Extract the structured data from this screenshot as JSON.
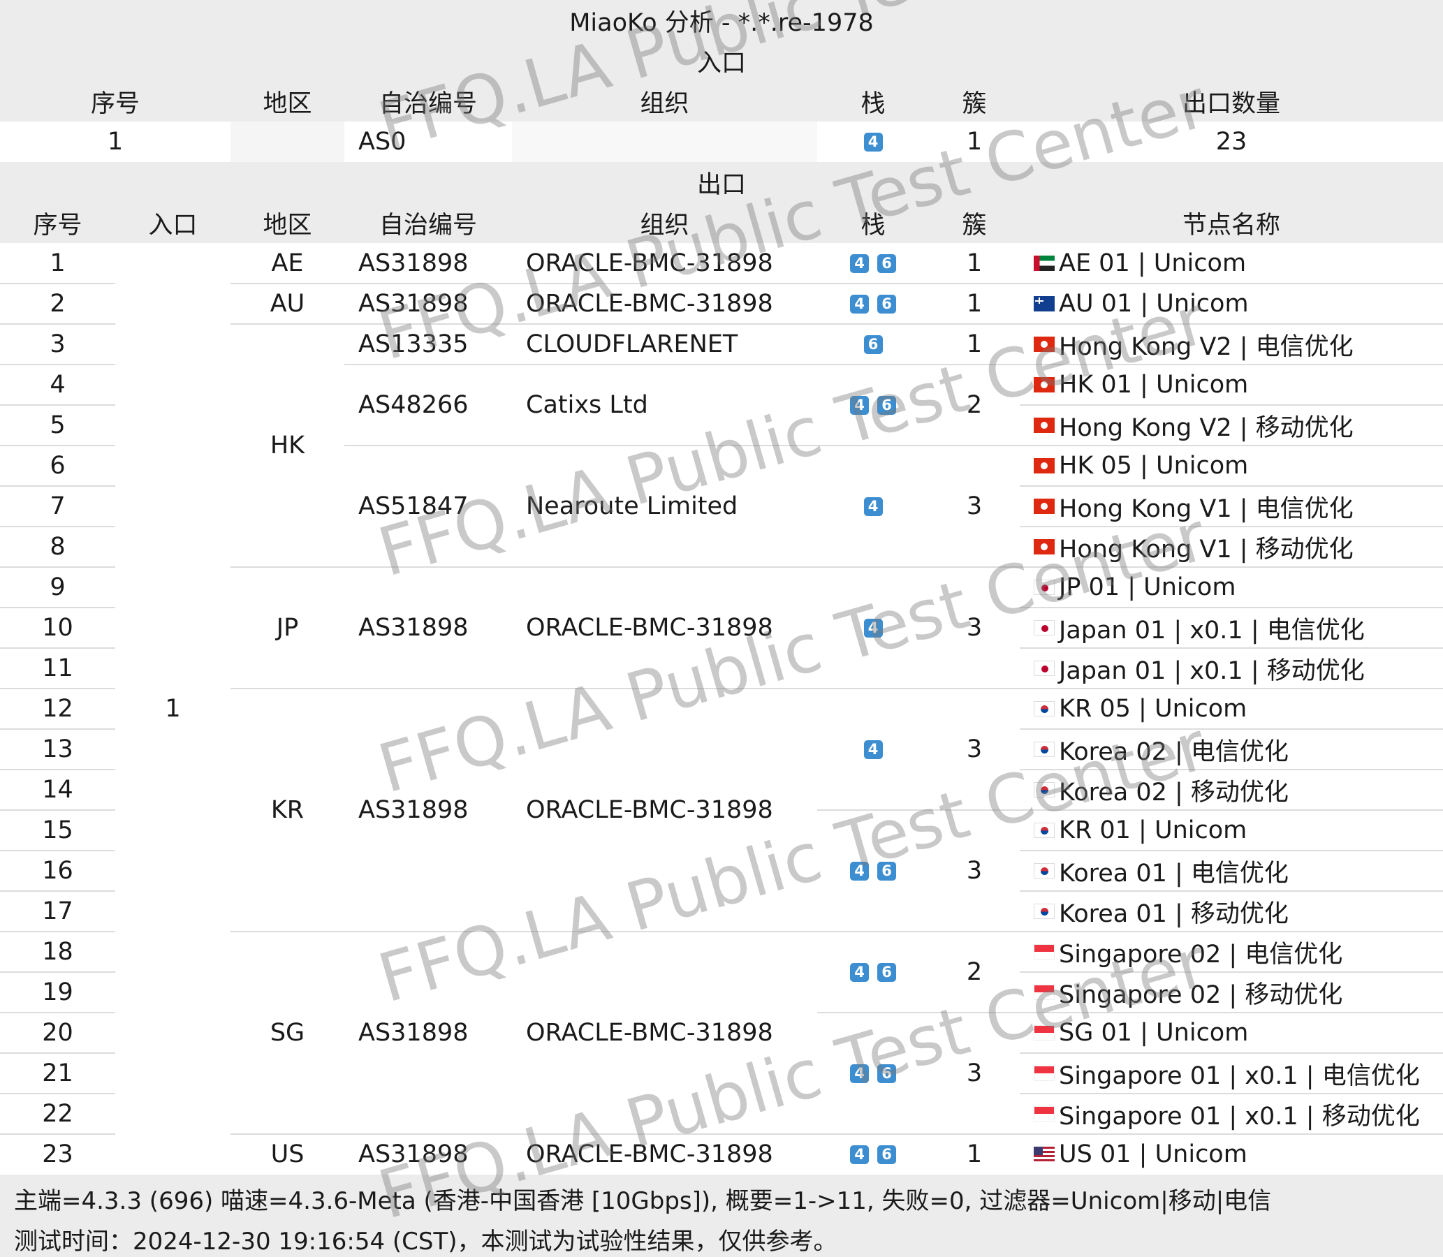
{
  "title": "MiaoKo 分析 - *.*.re-1978",
  "entry_section": {
    "label": "入口",
    "headers": [
      "序号",
      "地区",
      "自治编号",
      "组织",
      "栈",
      "簇",
      "出口数量"
    ],
    "row": {
      "index": "1",
      "region": "",
      "asn": "AS0",
      "org": "",
      "stack": [
        "4"
      ],
      "cluster": "1",
      "exit_count": "23"
    }
  },
  "exit_section": {
    "label": "出口",
    "headers": [
      "序号",
      "入口",
      "地区",
      "自治编号",
      "组织",
      "栈",
      "簇",
      "节点名称"
    ],
    "entry_value": "1",
    "indices": [
      "1",
      "2",
      "3",
      "4",
      "5",
      "6",
      "7",
      "8",
      "9",
      "10",
      "11",
      "12",
      "13",
      "14",
      "15",
      "16",
      "17",
      "18",
      "19",
      "20",
      "21",
      "22",
      "23"
    ],
    "region_groups": [
      {
        "region": "AE",
        "rows": 1
      },
      {
        "region": "AU",
        "rows": 1
      },
      {
        "region": "HK",
        "rows": 6
      },
      {
        "region": "JP",
        "rows": 3
      },
      {
        "region": "KR",
        "rows": 6
      },
      {
        "region": "SG",
        "rows": 5
      },
      {
        "region": "US",
        "rows": 1
      }
    ],
    "asn_groups": [
      {
        "asn": "AS31898",
        "org": "ORACLE-BMC-31898",
        "rows": 1
      },
      {
        "asn": "AS31898",
        "org": "ORACLE-BMC-31898",
        "rows": 1
      },
      {
        "asn": "AS13335",
        "org": "CLOUDFLARENET",
        "rows": 1
      },
      {
        "asn": "AS48266",
        "org": "Catixs Ltd",
        "rows": 2
      },
      {
        "asn": "AS51847",
        "org": "Nearoute Limited",
        "rows": 3
      },
      {
        "asn": "AS31898",
        "org": "ORACLE-BMC-31898",
        "rows": 3
      },
      {
        "asn": "AS31898",
        "org": "ORACLE-BMC-31898",
        "rows": 6
      },
      {
        "asn": "AS31898",
        "org": "ORACLE-BMC-31898",
        "rows": 5
      },
      {
        "asn": "AS31898",
        "org": "ORACLE-BMC-31898",
        "rows": 1
      }
    ],
    "cluster_groups": [
      {
        "stack": [
          "4",
          "6"
        ],
        "cluster": "1",
        "rows": 1
      },
      {
        "stack": [
          "4",
          "6"
        ],
        "cluster": "1",
        "rows": 1
      },
      {
        "stack": [
          "6"
        ],
        "cluster": "1",
        "rows": 1
      },
      {
        "stack": [
          "4",
          "6"
        ],
        "cluster": "2",
        "rows": 2
      },
      {
        "stack": [
          "4"
        ],
        "cluster": "3",
        "rows": 3
      },
      {
        "stack": [
          "4"
        ],
        "cluster": "3",
        "rows": 3
      },
      {
        "stack": [
          "4"
        ],
        "cluster": "3",
        "rows": 3
      },
      {
        "stack": [
          "4",
          "6"
        ],
        "cluster": "3",
        "rows": 3
      },
      {
        "stack": [
          "4",
          "6"
        ],
        "cluster": "2",
        "rows": 2
      },
      {
        "stack": [
          "4",
          "6"
        ],
        "cluster": "3",
        "rows": 3
      },
      {
        "stack": [
          "4",
          "6"
        ],
        "cluster": "1",
        "rows": 1
      }
    ],
    "nodes": [
      {
        "flag": "ae-flag-icon",
        "name": "AE 01 | Unicom"
      },
      {
        "flag": "au-flag-icon",
        "name": "AU 01 | Unicom"
      },
      {
        "flag": "hk-flag-icon",
        "name": "Hong Kong V2 | 电信优化"
      },
      {
        "flag": "hk-flag-icon",
        "name": "HK 01 | Unicom"
      },
      {
        "flag": "hk-flag-icon",
        "name": "Hong Kong V2 | 移动优化"
      },
      {
        "flag": "hk-flag-icon",
        "name": "HK 05 | Unicom"
      },
      {
        "flag": "hk-flag-icon",
        "name": "Hong Kong V1 | 电信优化"
      },
      {
        "flag": "hk-flag-icon",
        "name": "Hong Kong V1 | 移动优化"
      },
      {
        "flag": "jp-flag-icon",
        "name": "JP 01 | Unicom"
      },
      {
        "flag": "jp-flag-icon",
        "name": "Japan 01 | x0.1 | 电信优化"
      },
      {
        "flag": "jp-flag-icon",
        "name": "Japan 01 | x0.1 | 移动优化"
      },
      {
        "flag": "kr-flag-icon",
        "name": "KR 05 | Unicom"
      },
      {
        "flag": "kr-flag-icon",
        "name": "Korea 02 | 电信优化"
      },
      {
        "flag": "kr-flag-icon",
        "name": "Korea 02 | 移动优化"
      },
      {
        "flag": "kr-flag-icon",
        "name": "KR 01 | Unicom"
      },
      {
        "flag": "kr-flag-icon",
        "name": "Korea 01 | 电信优化"
      },
      {
        "flag": "kr-flag-icon",
        "name": "Korea 01 | 移动优化"
      },
      {
        "flag": "sg-flag-icon",
        "name": "Singapore 02 | 电信优化"
      },
      {
        "flag": "sg-flag-icon",
        "name": "Singapore 02 | 移动优化"
      },
      {
        "flag": "sg-flag-icon",
        "name": "SG 01 | Unicom"
      },
      {
        "flag": "sg-flag-icon",
        "name": "Singapore 01 | x0.1 | 电信优化"
      },
      {
        "flag": "sg-flag-icon",
        "name": "Singapore 01 | x0.1 | 移动优化"
      },
      {
        "flag": "us-flag-icon",
        "name": "US 01 | Unicom"
      }
    ]
  },
  "footer": {
    "line1": "主端=4.3.3 (696) 喵速=4.3.6-Meta (香港-中国香港 [10Gbps]), 概要=1->11, 失败=0, 过滤器=Unicom|移动|电信",
    "line2": "测试时间：2024-12-30 19:16:54 (CST)，本测试为试验性结果，仅供参考。"
  },
  "watermark": "FFQ.LA Public Test Center",
  "colors": {
    "header_bg": "#ececec",
    "badge": "#3c8ed0",
    "border": "#dcdcdc"
  }
}
